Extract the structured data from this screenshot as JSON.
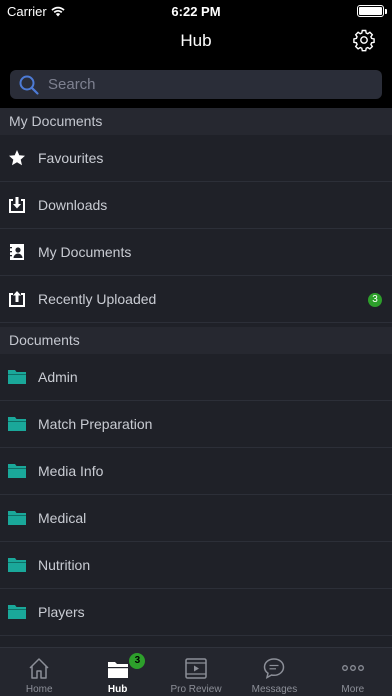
{
  "status_bar": {
    "carrier": "Carrier",
    "time": "6:22 PM"
  },
  "header": {
    "title": "Hub"
  },
  "search": {
    "placeholder": "Search"
  },
  "sections": [
    {
      "title": "My Documents",
      "items": [
        {
          "label": "Favourites",
          "icon": "star-icon"
        },
        {
          "label": "Downloads",
          "icon": "download-icon"
        },
        {
          "label": "My Documents",
          "icon": "personal-folder-icon"
        },
        {
          "label": "Recently Uploaded",
          "icon": "upload-icon",
          "badge": "3"
        }
      ]
    },
    {
      "title": "Documents",
      "items": [
        {
          "label": "Admin",
          "icon": "folder-icon"
        },
        {
          "label": "Match Preparation",
          "icon": "folder-icon"
        },
        {
          "label": "Media Info",
          "icon": "folder-icon"
        },
        {
          "label": "Medical",
          "icon": "folder-icon"
        },
        {
          "label": "Nutrition",
          "icon": "folder-icon"
        },
        {
          "label": "Players",
          "icon": "folder-icon"
        }
      ]
    }
  ],
  "tabbar": {
    "tabs": [
      {
        "label": "Home",
        "icon": "home-icon",
        "active": false
      },
      {
        "label": "Hub",
        "icon": "hub-icon",
        "active": true,
        "badge": "3"
      },
      {
        "label": "Pro Review",
        "icon": "video-icon",
        "active": false
      },
      {
        "label": "Messages",
        "icon": "chat-icon",
        "active": false
      },
      {
        "label": "More",
        "icon": "more-icon",
        "active": false
      }
    ]
  },
  "colors": {
    "accent_teal": "#1aa89a",
    "badge_green": "#2d9f2b",
    "background": "#1f2128",
    "header_background": "#000000"
  }
}
